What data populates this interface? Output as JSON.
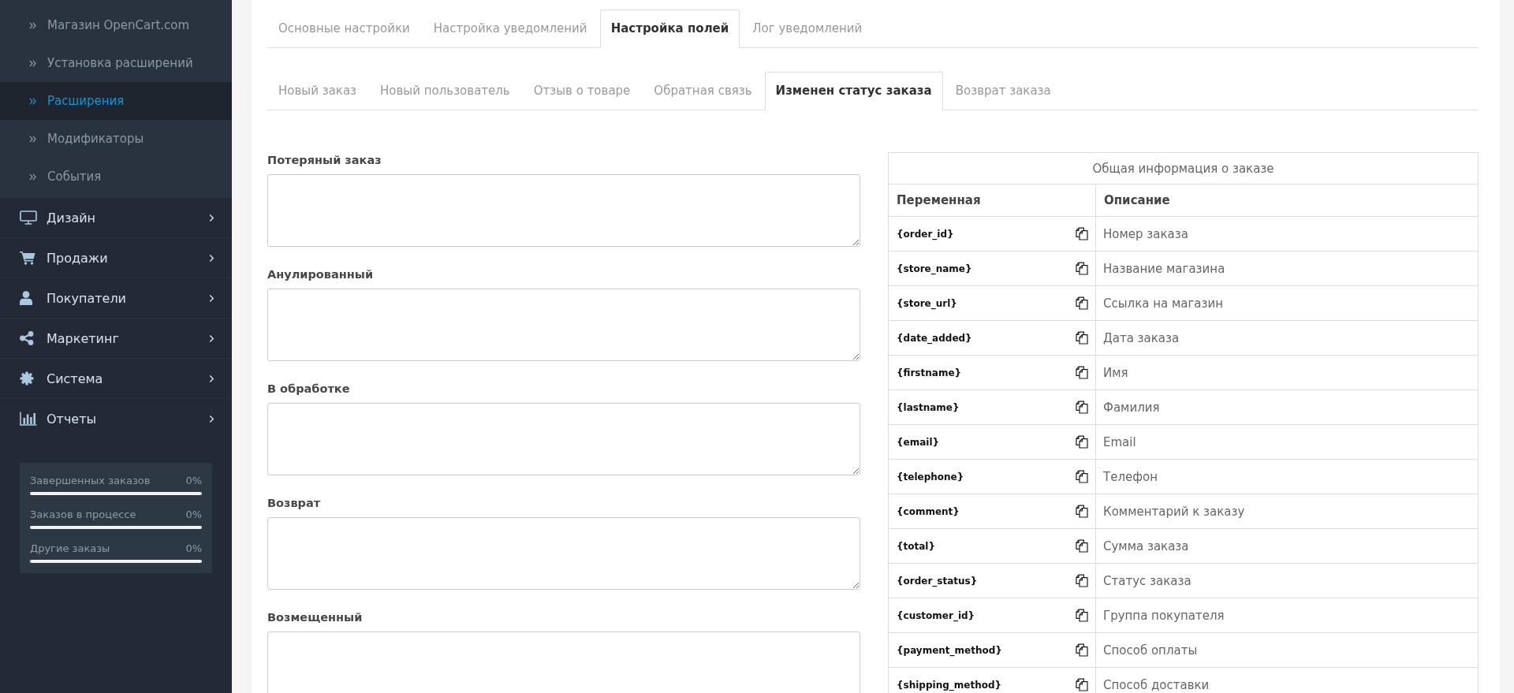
{
  "sidebar": {
    "submenu": [
      {
        "label": "Магазин OpenCart.com",
        "selected": false
      },
      {
        "label": "Установка расширений",
        "selected": false
      },
      {
        "label": "Расширения",
        "selected": true
      },
      {
        "label": "Модификаторы",
        "selected": false
      },
      {
        "label": "События",
        "selected": false
      }
    ],
    "menu": [
      {
        "label": "Дизайн"
      },
      {
        "label": "Продажи"
      },
      {
        "label": "Покупатели"
      },
      {
        "label": "Маркетинг"
      },
      {
        "label": "Система"
      },
      {
        "label": "Отчеты"
      }
    ],
    "stats": [
      {
        "label": "Завершенных заказов",
        "value": "0%",
        "level": 0
      },
      {
        "label": "Заказов в процессе",
        "value": "0%",
        "level": 0
      },
      {
        "label": "Другие заказы",
        "value": "0%",
        "level": 0
      }
    ]
  },
  "tabs": [
    {
      "label": "Основные настройки",
      "selected": false
    },
    {
      "label": "Настройка уведомлений",
      "selected": false
    },
    {
      "label": "Настройка полей",
      "selected": true
    },
    {
      "label": "Лог уведомлений",
      "selected": false
    }
  ],
  "subtabs": [
    {
      "label": "Новый заказ",
      "selected": false
    },
    {
      "label": "Новый пользователь",
      "selected": false
    },
    {
      "label": "Отзыв о товаре",
      "selected": false
    },
    {
      "label": "Обратная связь",
      "selected": false
    },
    {
      "label": "Изменен статус заказа",
      "selected": true
    },
    {
      "label": "Возврат заказа",
      "selected": false
    }
  ],
  "fields": [
    {
      "label": "Потеряный заказ"
    },
    {
      "label": "Анулированный"
    },
    {
      "label": "В обработке"
    },
    {
      "label": "Возврат"
    },
    {
      "label": "Возмещенный"
    }
  ],
  "variables_table": {
    "title": "Общая информация о заказе",
    "columns": [
      "Переменная",
      "Описание"
    ],
    "rows": [
      {
        "variable": "{order_id}",
        "description": "Номер заказа"
      },
      {
        "variable": "{store_name}",
        "description": "Название магазина"
      },
      {
        "variable": "{store_url}",
        "description": "Ссылка на магазин"
      },
      {
        "variable": "{date_added}",
        "description": "Дата заказа"
      },
      {
        "variable": "{firstname}",
        "description": "Имя"
      },
      {
        "variable": "{lastname}",
        "description": "Фамилия"
      },
      {
        "variable": "{email}",
        "description": "Email"
      },
      {
        "variable": "{telephone}",
        "description": "Телефон"
      },
      {
        "variable": "{comment}",
        "description": "Комментарий к заказу"
      },
      {
        "variable": "{total}",
        "description": "Сумма заказа"
      },
      {
        "variable": "{order_status}",
        "description": "Статус заказа"
      },
      {
        "variable": "{customer_id}",
        "description": "Группа покупателя"
      },
      {
        "variable": "{payment_method}",
        "description": "Способ оплаты"
      },
      {
        "variable": "{shipping_method}",
        "description": "Способ доставки"
      }
    ]
  }
}
